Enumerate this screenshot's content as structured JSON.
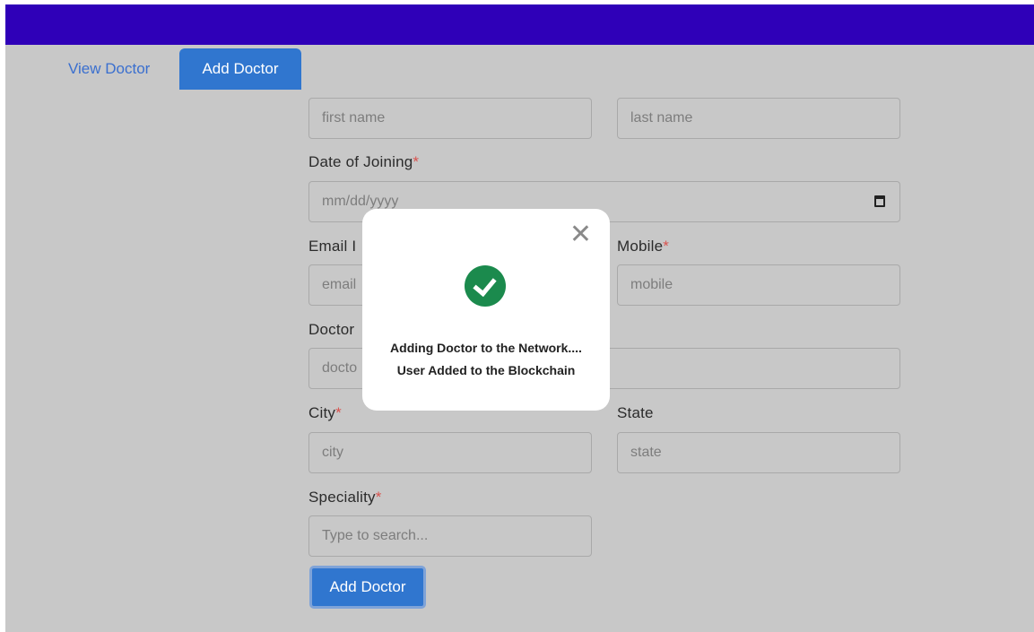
{
  "tabs": {
    "view_label": "View Doctor",
    "add_label": "Add Doctor"
  },
  "form": {
    "first_name": {
      "placeholder": "first name"
    },
    "last_name": {
      "placeholder": "last name"
    },
    "doj": {
      "label": "Date of Joining",
      "required": "*",
      "placeholder": "mm/dd/yyyy"
    },
    "email": {
      "label": "Email I",
      "placeholder": "email"
    },
    "mobile": {
      "label": "Mobile",
      "required": "*",
      "placeholder": "mobile"
    },
    "doctor": {
      "label": "Doctor",
      "placeholder": "docto"
    },
    "city": {
      "label": "City",
      "required": "*",
      "placeholder": "city"
    },
    "state": {
      "label": "State",
      "placeholder": "state"
    },
    "speciality": {
      "label": "Speciality",
      "required": "*",
      "placeholder": "Type to search..."
    },
    "submit_label": "Add Doctor"
  },
  "modal": {
    "close_glyph": "✕",
    "line1": "Adding Doctor to the Network....",
    "line2": "User Added to the Blockchain"
  },
  "colors": {
    "topbar": "#2f00b8",
    "accent": "#3076cf",
    "success": "#1b8a4d",
    "required": "#d9534f"
  }
}
